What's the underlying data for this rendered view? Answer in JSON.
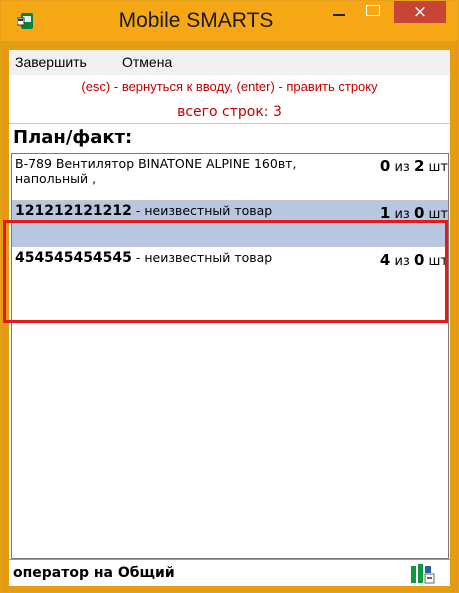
{
  "window": {
    "title": "Mobile SMARTS",
    "controls": {
      "minimize": "minimize",
      "maximize": "maximize",
      "close": "×"
    }
  },
  "menu": {
    "items": [
      "Завершить",
      "Отмена"
    ]
  },
  "hint": "(esc) - вернуться к вводу, (enter) - править строку",
  "row_count": "всего строк: 3",
  "section_title": "План/факт:",
  "items": [
    {
      "code": "",
      "name": "B-789 Вентилятор BINATONE ALPINE 160вт, напольный ,",
      "fact": "0",
      "sep": "из",
      "plan": "2",
      "unit": "шт"
    },
    {
      "code": "121212121212",
      "name": " - неизвестный товар",
      "fact": "1",
      "sep": "из",
      "plan": "0",
      "unit": "шт"
    },
    {
      "code": "454545454545",
      "name": " - неизвестный товар",
      "fact": "4",
      "sep": "из",
      "plan": "0",
      "unit": "шт"
    }
  ],
  "status": {
    "operator": "оператор на Общий"
  },
  "colors": {
    "titlebar": "#f5a716",
    "close": "#c74536",
    "hint": "#c00000",
    "selection": "#b8c6df",
    "highlight_border": "#e3191e"
  }
}
